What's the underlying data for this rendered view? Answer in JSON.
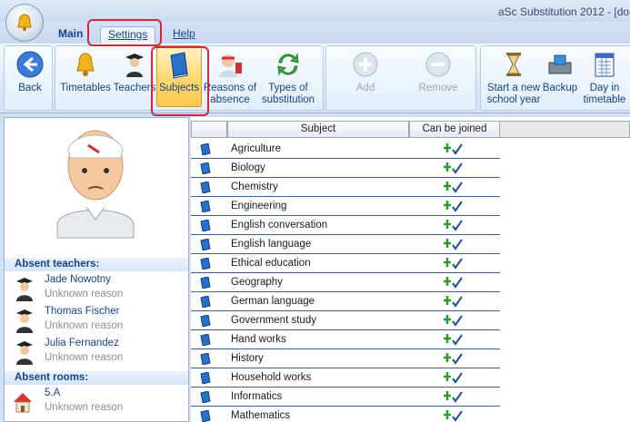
{
  "window": {
    "title": "aSc Substitution 2012 - [doc"
  },
  "tabs": [
    {
      "label": "Main"
    },
    {
      "label": "Settings"
    },
    {
      "label": "Help"
    }
  ],
  "ribbon": {
    "back": "Back",
    "timetables": "Timetables",
    "teachers": "Teachers",
    "subjects": "Subjects",
    "reasons": [
      "Reasons of",
      "absence"
    ],
    "types": [
      "Types of",
      "substitution"
    ],
    "add": "Add",
    "remove": "Remove",
    "new_year": [
      "Start a new",
      "school year"
    ],
    "backup": "Backup",
    "day_in_tt": [
      "Day in",
      "timetable"
    ]
  },
  "left": {
    "absent_teachers_label": "Absent teachers:",
    "teachers": [
      {
        "name": "Jade Nowotny",
        "reason": "Unknown reason"
      },
      {
        "name": "Thomas Fischer",
        "reason": "Unknown reason"
      },
      {
        "name": "Julia Fernandez",
        "reason": "Unknown reason"
      }
    ],
    "absent_rooms_label": "Absent rooms:",
    "rooms": [
      {
        "name": "5.A",
        "reason": "Unknown reason"
      }
    ]
  },
  "grid": {
    "col_subject": "Subject",
    "col_joined": "Can be joined",
    "rows": [
      "Agriculture",
      "Biology",
      "Chemistry",
      "Engineering",
      "English conversation",
      "English language",
      "Ethical education",
      "Geography",
      "German language",
      "Government study",
      "Hand works",
      "History",
      "Household works",
      "Informatics",
      "Mathematics"
    ]
  },
  "colors": {
    "accent": "#15428b",
    "highlight": "#d4273a",
    "selected": "#ffd56b"
  }
}
